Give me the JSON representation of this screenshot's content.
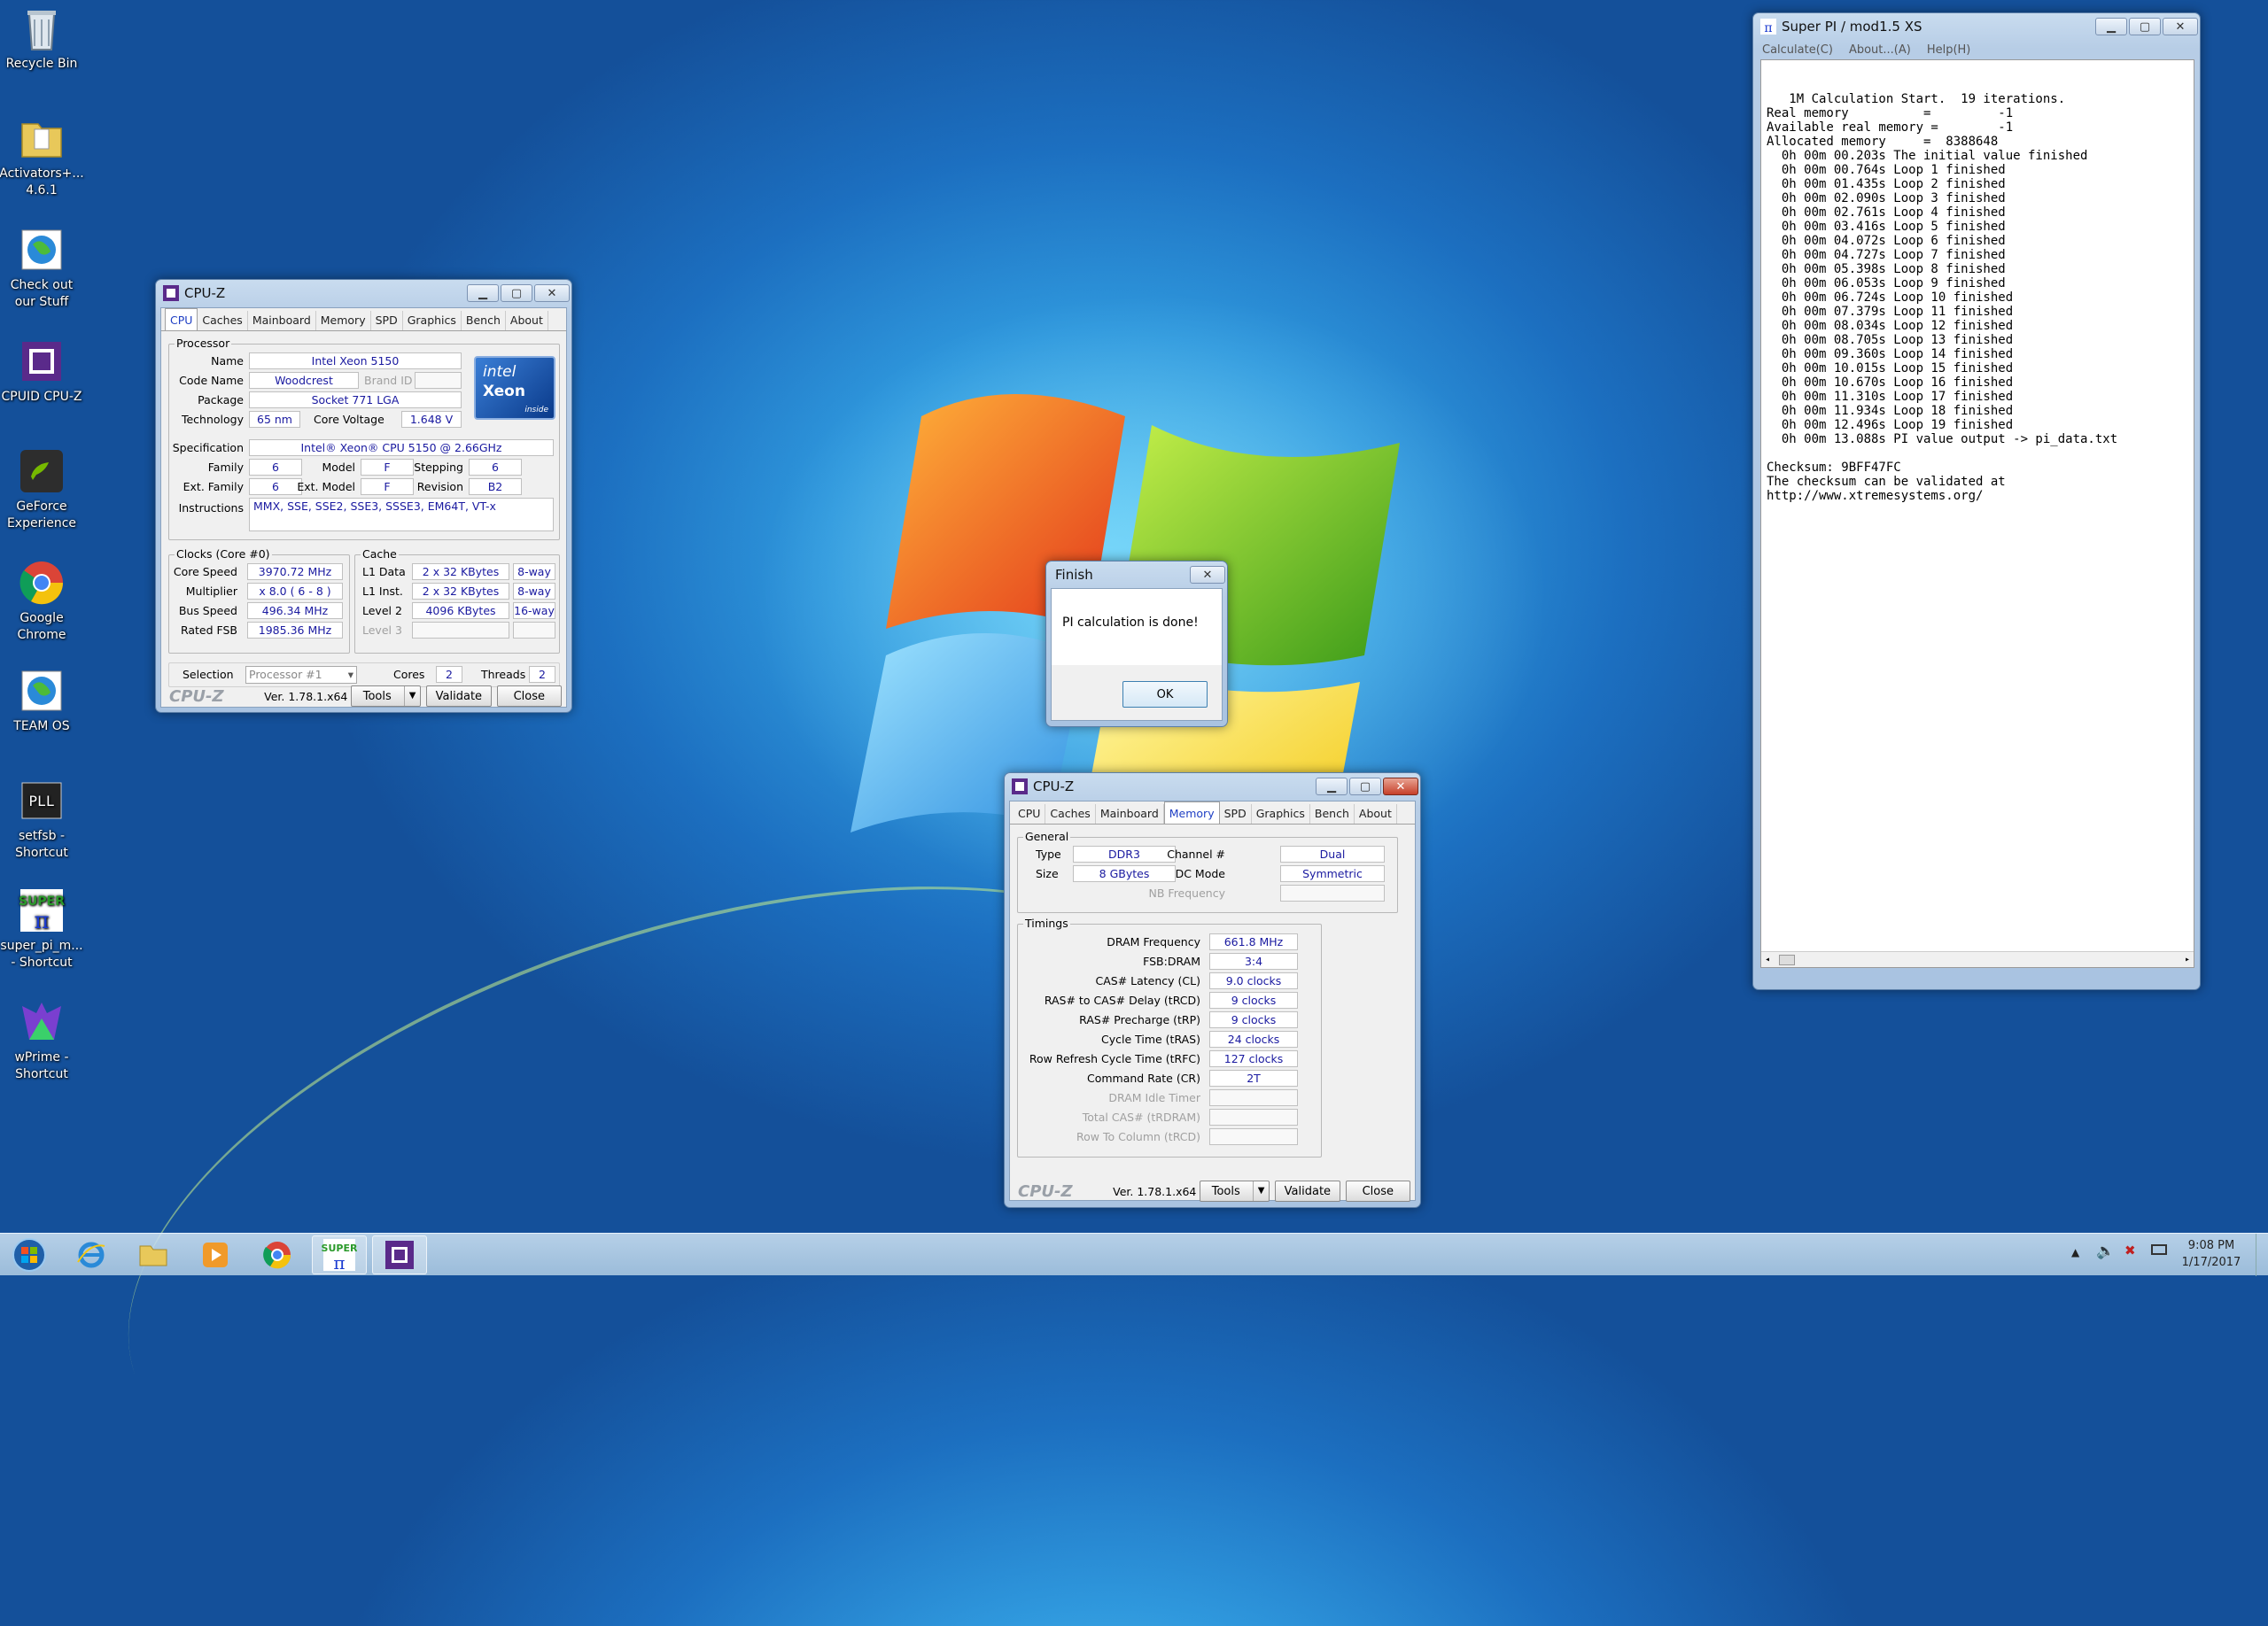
{
  "desktop": {
    "icons": [
      {
        "label": "Recycle Bin"
      },
      {
        "label": "Activators+... 4.6.1"
      },
      {
        "label": "Check out our Stuff"
      },
      {
        "label": "CPUID CPU-Z"
      },
      {
        "label": "GeForce Experience"
      },
      {
        "label": "Google Chrome"
      },
      {
        "label": "TEAM OS"
      },
      {
        "label": "setfsb - Shortcut"
      },
      {
        "label": "super_pi_m... - Shortcut"
      },
      {
        "label": "wPrime - Shortcut"
      }
    ]
  },
  "cpuz1": {
    "title": "CPU-Z",
    "tabs": [
      "CPU",
      "Caches",
      "Mainboard",
      "Memory",
      "SPD",
      "Graphics",
      "Bench",
      "About"
    ],
    "active_tab": "CPU",
    "processor_group": "Processor",
    "labels": {
      "name": "Name",
      "code_name": "Code Name",
      "brand_id": "Brand ID",
      "package": "Package",
      "technology": "Technology",
      "core_voltage": "Core Voltage",
      "specification": "Specification",
      "family": "Family",
      "model": "Model",
      "stepping": "Stepping",
      "ext_family": "Ext. Family",
      "ext_model": "Ext. Model",
      "revision": "Revision",
      "instructions": "Instructions"
    },
    "values": {
      "name": "Intel Xeon 5150",
      "code_name": "Woodcrest",
      "package": "Socket 771 LGA",
      "technology": "65 nm",
      "core_voltage": "1.648 V",
      "specification": "Intel® Xeon® CPU            5150  @ 2.66GHz",
      "family": "6",
      "model": "F",
      "stepping": "6",
      "ext_family": "6",
      "ext_model": "F",
      "revision": "B2",
      "instructions": "MMX, SSE, SSE2, SSE3, SSSE3, EM64T, VT-x"
    },
    "clocks_group": "Clocks (Core #0)",
    "clocks": {
      "core_speed_label": "Core Speed",
      "core_speed": "3970.72 MHz",
      "multiplier_label": "Multiplier",
      "multiplier": "x 8.0 ( 6 - 8 )",
      "bus_speed_label": "Bus Speed",
      "bus_speed": "496.34 MHz",
      "rated_fsb_label": "Rated FSB",
      "rated_fsb": "1985.36 MHz"
    },
    "cache_group": "Cache",
    "cache": {
      "l1d_label": "L1 Data",
      "l1d": "2 x 32 KBytes",
      "l1d_way": "8-way",
      "l1i_label": "L1 Inst.",
      "l1i": "2 x 32 KBytes",
      "l1i_way": "8-way",
      "l2_label": "Level 2",
      "l2": "4096 KBytes",
      "l2_way": "16-way",
      "l3_label": "Level 3"
    },
    "selection_label": "Selection",
    "selection_value": "Processor #1",
    "cores_label": "Cores",
    "cores": "2",
    "threads_label": "Threads",
    "threads": "2",
    "logo_text": "CPU-Z",
    "version": "Ver. 1.78.1.x64",
    "buttons": {
      "tools": "Tools",
      "validate": "Validate",
      "close": "Close"
    },
    "intel_badge": {
      "brand": "intel",
      "product": "Xeon",
      "tag": "inside"
    }
  },
  "cpuz2": {
    "title": "CPU-Z",
    "tabs": [
      "CPU",
      "Caches",
      "Mainboard",
      "Memory",
      "SPD",
      "Graphics",
      "Bench",
      "About"
    ],
    "active_tab": "Memory",
    "general_group": "General",
    "general": {
      "type_label": "Type",
      "type": "DDR3",
      "size_label": "Size",
      "size": "8 GBytes",
      "channel_label": "Channel #",
      "channel": "Dual",
      "dc_mode_label": "DC Mode",
      "dc_mode": "Symmetric",
      "nb_freq_label": "NB Frequency"
    },
    "timings_group": "Timings",
    "timings": [
      {
        "label": "DRAM Frequency",
        "value": "661.8 MHz",
        "disabled": false
      },
      {
        "label": "FSB:DRAM",
        "value": "3:4",
        "disabled": false
      },
      {
        "label": "CAS# Latency (CL)",
        "value": "9.0 clocks",
        "disabled": false
      },
      {
        "label": "RAS# to CAS# Delay (tRCD)",
        "value": "9 clocks",
        "disabled": false
      },
      {
        "label": "RAS# Precharge (tRP)",
        "value": "9 clocks",
        "disabled": false
      },
      {
        "label": "Cycle Time (tRAS)",
        "value": "24 clocks",
        "disabled": false
      },
      {
        "label": "Row Refresh Cycle Time (tRFC)",
        "value": "127 clocks",
        "disabled": false
      },
      {
        "label": "Command Rate (CR)",
        "value": "2T",
        "disabled": false
      },
      {
        "label": "DRAM Idle Timer",
        "value": "",
        "disabled": true
      },
      {
        "label": "Total CAS# (tRDRAM)",
        "value": "",
        "disabled": true
      },
      {
        "label": "Row To Column (tRCD)",
        "value": "",
        "disabled": true
      }
    ],
    "logo_text": "CPU-Z",
    "version": "Ver. 1.78.1.x64",
    "buttons": {
      "tools": "Tools",
      "validate": "Validate",
      "close": "Close"
    }
  },
  "finish_dialog": {
    "title": "Finish",
    "message": "PI calculation is done!",
    "ok": "OK"
  },
  "superpi": {
    "title": "Super PI / mod1.5 XS",
    "menu": [
      "Calculate(C)",
      "About...(A)",
      "Help(H)"
    ],
    "output": [
      "   1M Calculation Start.  19 iterations.",
      "Real memory          =         -1",
      "Available real memory =        -1",
      "Allocated memory     =  8388648",
      "  0h 00m 00.203s The initial value finished",
      "  0h 00m 00.764s Loop 1 finished",
      "  0h 00m 01.435s Loop 2 finished",
      "  0h 00m 02.090s Loop 3 finished",
      "  0h 00m 02.761s Loop 4 finished",
      "  0h 00m 03.416s Loop 5 finished",
      "  0h 00m 04.072s Loop 6 finished",
      "  0h 00m 04.727s Loop 7 finished",
      "  0h 00m 05.398s Loop 8 finished",
      "  0h 00m 06.053s Loop 9 finished",
      "  0h 00m 06.724s Loop 10 finished",
      "  0h 00m 07.379s Loop 11 finished",
      "  0h 00m 08.034s Loop 12 finished",
      "  0h 00m 08.705s Loop 13 finished",
      "  0h 00m 09.360s Loop 14 finished",
      "  0h 00m 10.015s Loop 15 finished",
      "  0h 00m 10.670s Loop 16 finished",
      "  0h 00m 11.310s Loop 17 finished",
      "  0h 00m 11.934s Loop 18 finished",
      "  0h 00m 12.496s Loop 19 finished",
      "  0h 00m 13.088s PI value output -> pi_data.txt",
      "",
      "Checksum: 9BFF47FC",
      "The checksum can be validated at",
      "http://www.xtremesystems.org/"
    ]
  },
  "taskbar": {
    "time": "9:08 PM",
    "date": "1/17/2017",
    "pinned": [
      "start-button",
      "internet-explorer",
      "file-explorer",
      "media-player",
      "google-chrome",
      "super-pi",
      "cpu-z"
    ]
  },
  "colors": {
    "accent_blue": "#1f3fc4",
    "value_text": "#1a1aa0",
    "close_red": "#c6402a"
  }
}
